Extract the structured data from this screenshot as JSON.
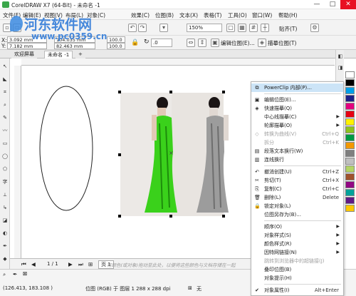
{
  "window": {
    "title": "CorelDRAW X7 (64-Bit) - 未命名 -1",
    "minimize": "—",
    "maximize": "□",
    "close": "✕"
  },
  "watermark": {
    "site_name": "河东软件网",
    "url": "www.pc0359.cn"
  },
  "menubar": {
    "items": [
      "文件(F)",
      "编辑(E)",
      "视图(V)",
      "布局(L)",
      "对象(C)",
      "效果(C)",
      "位图(B)",
      "文本(X)",
      "表格(T)",
      "工具(O)",
      "窗口(W)",
      "帮助(H)"
    ]
  },
  "toolbar": {
    "zoom_value": "150%",
    "snap_label": "贴齐(T)",
    "x_value": "3.092 mm",
    "y_value": "7.182 mm",
    "width_value": "104.035 mm",
    "height_value": "82.463 mm",
    "scale_x": "100.0",
    "scale_y": "100.0",
    "rotation_value": ".0",
    "edit_bitmap_label": "编辑位图(E)...",
    "trace_bitmap_label": "描摹位图(T)"
  },
  "tabs": {
    "welcome": "欢迎屏幕",
    "document": "未命名 -1",
    "add": "+"
  },
  "pagebar": {
    "page_indicator": "1 / 1",
    "page_tab": "页 1",
    "hint_text": "将颜色(或对象)拖动至此处，以便将这些颜色与文档存储在一起"
  },
  "statusbar": {
    "coordinates": "(126.413, 183.108 )",
    "object_info": "位图 (RGB) 于 图层 1 288 x 288 dpi",
    "fill_label": "无"
  },
  "context_menu": {
    "items": [
      {
        "label": "PowerClip 内部(P)...",
        "shortcut": "",
        "submenu": false,
        "disabled": false,
        "highlight": true,
        "icon": "powerclip-icon",
        "glyph": "⧉"
      },
      {
        "sep": true
      },
      {
        "label": "编辑位图(E)...",
        "shortcut": "",
        "submenu": false,
        "disabled": false,
        "highlight": false,
        "icon": "edit-bitmap-icon",
        "glyph": "▣"
      },
      {
        "label": "快速描摹(Q)",
        "shortcut": "",
        "submenu": false,
        "disabled": false,
        "highlight": false,
        "icon": "quick-trace-icon",
        "glyph": "◈"
      },
      {
        "label": "中心线描摹(C)",
        "shortcut": "",
        "submenu": true,
        "disabled": false,
        "highlight": false,
        "icon": "",
        "glyph": ""
      },
      {
        "label": "轮廓描摹(O)",
        "shortcut": "",
        "submenu": true,
        "disabled": false,
        "highlight": false,
        "icon": "",
        "glyph": ""
      },
      {
        "label": "转换为曲线(V)",
        "shortcut": "Ctrl+Q",
        "submenu": false,
        "disabled": true,
        "highlight": false,
        "icon": "convert-curve-icon",
        "glyph": "◇"
      },
      {
        "label": "拆分",
        "shortcut": "Ctrl+K",
        "submenu": false,
        "disabled": true,
        "highlight": false,
        "icon": "",
        "glyph": ""
      },
      {
        "label": "段落文本换行(W)",
        "shortcut": "",
        "submenu": false,
        "disabled": false,
        "highlight": false,
        "icon": "paragraph-wrap-icon",
        "glyph": "▤"
      },
      {
        "label": "连线换行",
        "shortcut": "",
        "submenu": false,
        "disabled": false,
        "highlight": false,
        "icon": "line-wrap-icon",
        "glyph": "▥"
      },
      {
        "sep": true
      },
      {
        "label": "撤消创建(U)",
        "shortcut": "Ctrl+Z",
        "submenu": false,
        "disabled": false,
        "highlight": false,
        "icon": "undo-icon",
        "glyph": "↶"
      },
      {
        "label": "剪切(T)",
        "shortcut": "Ctrl+X",
        "submenu": false,
        "disabled": false,
        "highlight": false,
        "icon": "cut-icon",
        "glyph": "✂"
      },
      {
        "label": "复制(C)",
        "shortcut": "Ctrl+C",
        "submenu": false,
        "disabled": false,
        "highlight": false,
        "icon": "copy-icon",
        "glyph": "⎘"
      },
      {
        "label": "删除(L)",
        "shortcut": "Delete",
        "submenu": false,
        "disabled": false,
        "highlight": false,
        "icon": "delete-icon",
        "glyph": "🗑"
      },
      {
        "label": "锁定对象(L)",
        "shortcut": "",
        "submenu": false,
        "disabled": false,
        "highlight": false,
        "icon": "lock-icon",
        "glyph": "🔒"
      },
      {
        "label": "位图另存为(B)...",
        "shortcut": "",
        "submenu": false,
        "disabled": false,
        "highlight": false,
        "icon": "",
        "glyph": ""
      },
      {
        "sep": true
      },
      {
        "label": "顺序(O)",
        "shortcut": "",
        "submenu": true,
        "disabled": false,
        "highlight": false,
        "icon": "",
        "glyph": ""
      },
      {
        "label": "对象样式(S)",
        "shortcut": "",
        "submenu": true,
        "disabled": false,
        "highlight": false,
        "icon": "",
        "glyph": ""
      },
      {
        "label": "颜色样式(R)",
        "shortcut": "",
        "submenu": true,
        "disabled": false,
        "highlight": false,
        "icon": "",
        "glyph": ""
      },
      {
        "label": "因特网链接(N)",
        "shortcut": "",
        "submenu": true,
        "disabled": false,
        "highlight": false,
        "icon": "",
        "glyph": ""
      },
      {
        "label": "跳转到浏览器中的超链接(J)",
        "shortcut": "",
        "submenu": false,
        "disabled": true,
        "highlight": false,
        "icon": "",
        "glyph": ""
      },
      {
        "label": "叠印位图(B)",
        "shortcut": "",
        "submenu": false,
        "disabled": false,
        "highlight": false,
        "icon": "",
        "glyph": ""
      },
      {
        "label": "对象提示(H)",
        "shortcut": "",
        "submenu": false,
        "disabled": false,
        "highlight": false,
        "icon": "",
        "glyph": ""
      },
      {
        "sep": true
      },
      {
        "label": "对象属性(I)",
        "shortcut": "Alt+Enter",
        "submenu": false,
        "disabled": false,
        "highlight": false,
        "icon": "check-icon",
        "glyph": "✔"
      }
    ]
  },
  "palette": {
    "colors": [
      "#ffffff",
      "#000000",
      "#00a0e9",
      "#1d2088",
      "#e4007f",
      "#e60012",
      "#fff100",
      "#8fc31f",
      "#009944",
      "#f39800",
      "#7f7f7f",
      "#c0c0c0",
      "#b3d465",
      "#a0522d",
      "#920783",
      "#00a29a",
      "#601986",
      "#fcc800"
    ]
  }
}
